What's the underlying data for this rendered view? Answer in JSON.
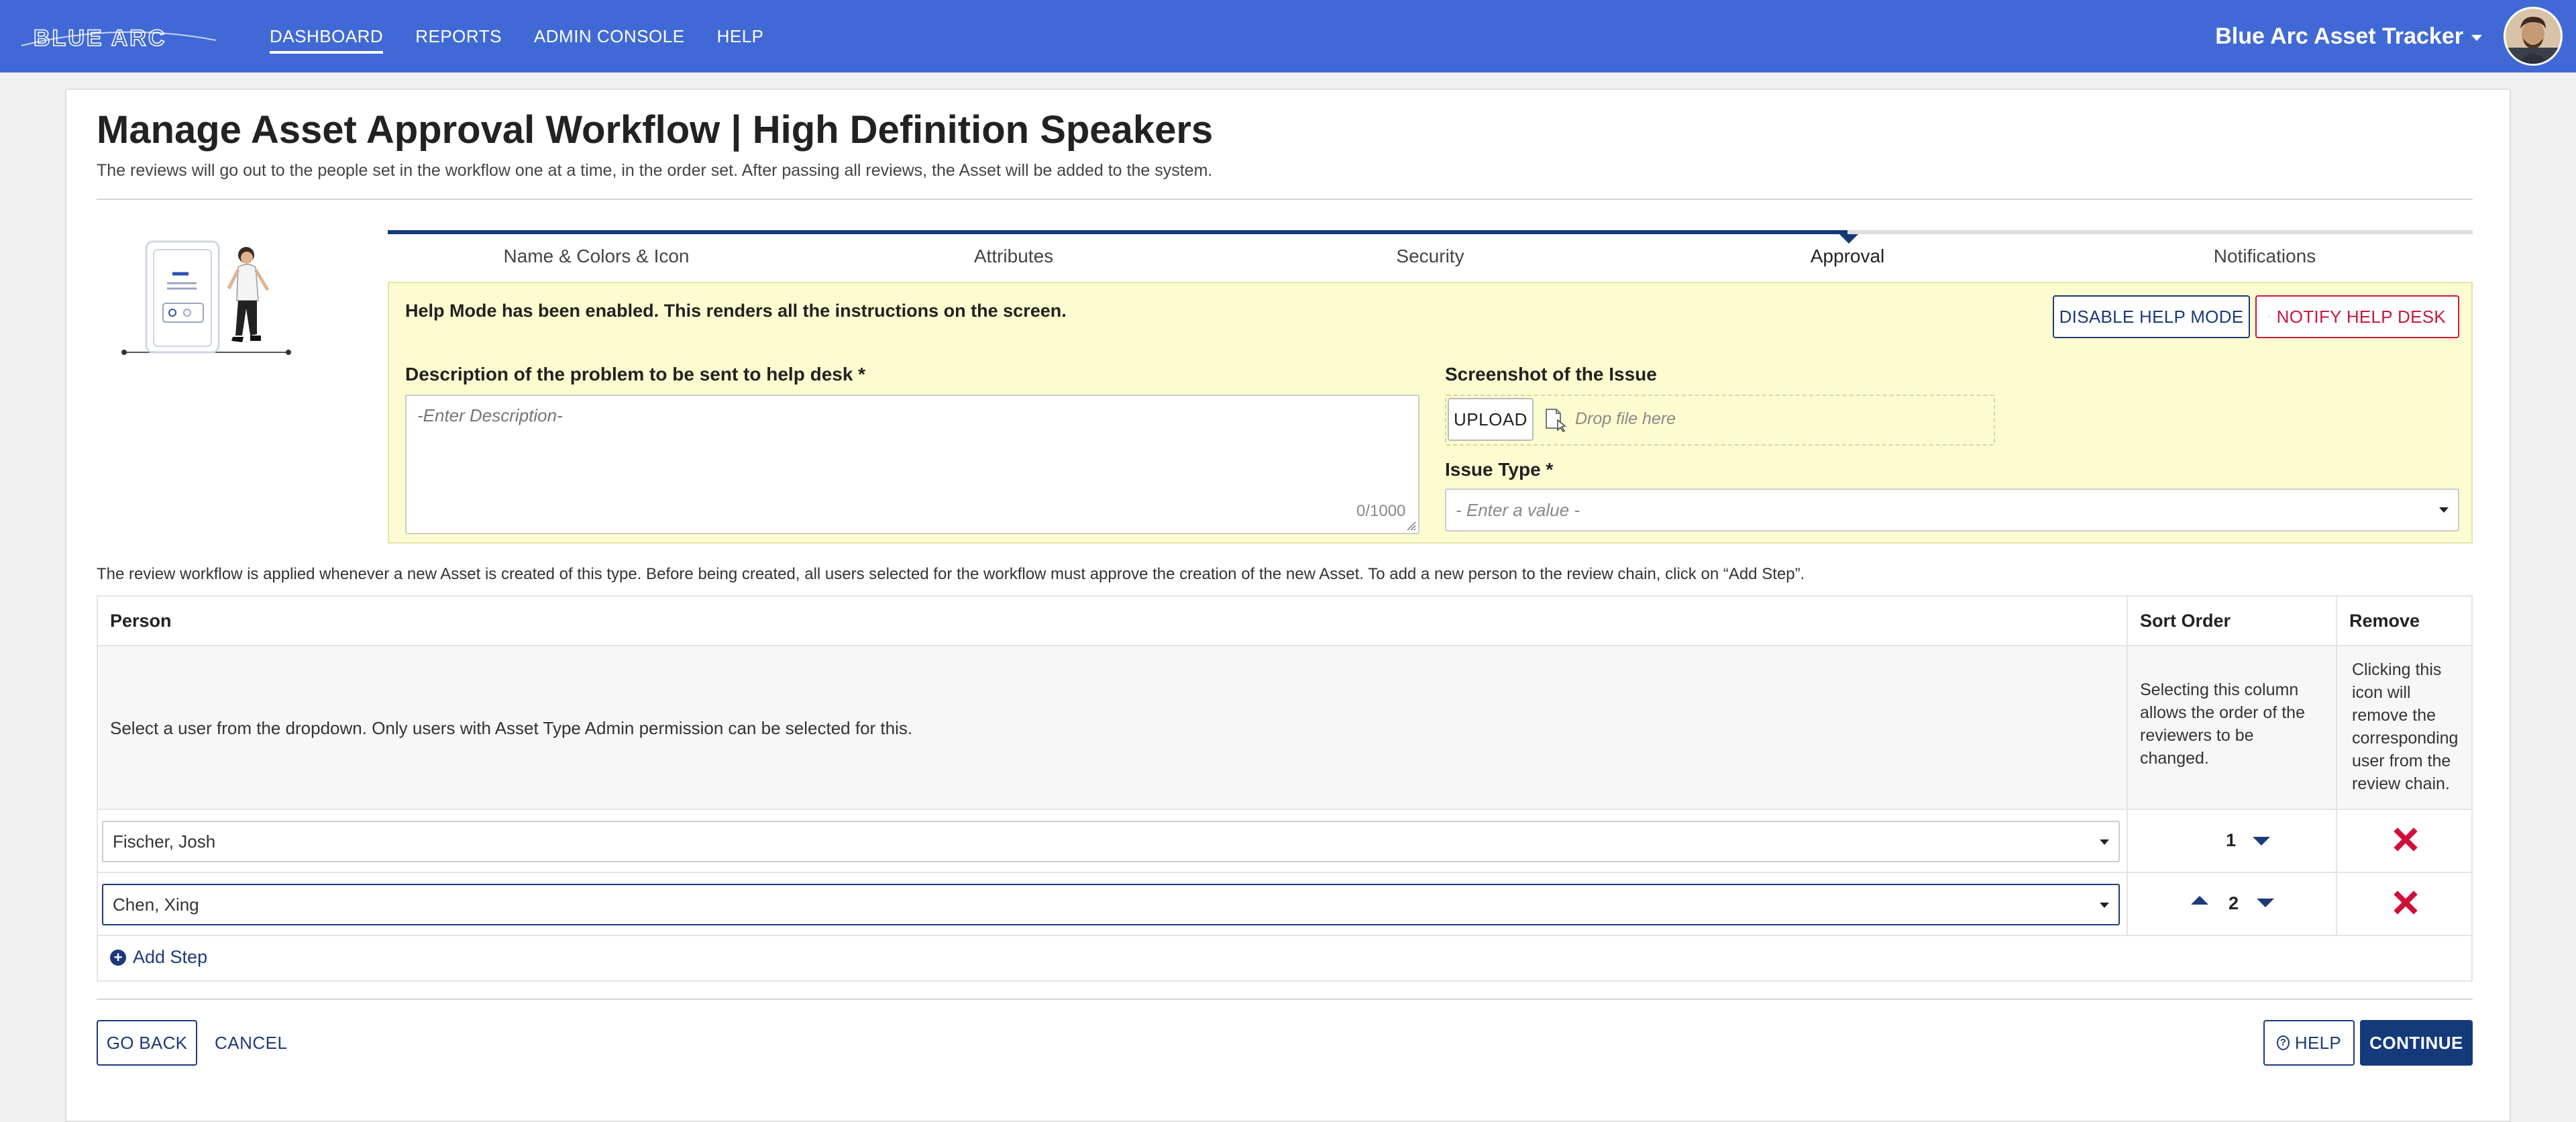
{
  "nav": {
    "logo_text": "BLUE ARC",
    "links": [
      {
        "label": "DASHBOARD",
        "active": true
      },
      {
        "label": "REPORTS",
        "active": false
      },
      {
        "label": "ADMIN CONSOLE",
        "active": false
      },
      {
        "label": "HELP",
        "active": false
      }
    ],
    "app_name": "Blue Arc Asset Tracker",
    "brand_color": "#4169d6"
  },
  "page": {
    "title": "Manage Asset Approval Workflow | High Definition Speakers",
    "subtitle": "The reviews will go out to the people set in the workflow one at a time, in the order set. After passing all reviews, the Asset will be added to the system."
  },
  "steps": {
    "items": [
      "Name & Colors & Icon",
      "Attributes",
      "Security",
      "Approval",
      "Notifications"
    ],
    "active_index": 3
  },
  "help_panel": {
    "notice": "Help Mode has been enabled. This renders all the instructions on the screen.",
    "disable_label": "DISABLE HELP MODE",
    "notify_label": "NOTIFY HELP DESK",
    "description_label": "Description of the problem to be sent to help desk *",
    "description_placeholder": "-Enter Description-",
    "char_count": "0/1000",
    "screenshot_label": "Screenshot of the Issue",
    "upload_label": "UPLOAD",
    "drop_text": "Drop file here",
    "issue_type_label": "Issue Type *",
    "issue_type_placeholder": "- Enter a value -",
    "background_color": "#fdfcd0"
  },
  "workflow": {
    "note": "The review workflow is applied whenever a new Asset is created of this type. Before being created, all users selected for the workflow must approve the creation of the new Asset. To add a new person to the review chain, click on “Add Step”.",
    "headers": {
      "person": "Person",
      "sort": "Sort Order",
      "remove": "Remove"
    },
    "help": {
      "person": "Select a user from the dropdown. Only users with Asset Type Admin permission can be selected for this.",
      "sort": "Selecting this column allows the order of the reviewers to be changed.",
      "remove": "Clicking this icon will remove the corresponding user from the review chain."
    },
    "rows": [
      {
        "person": "Fischer, Josh",
        "order": "1"
      },
      {
        "person": "Chen, Xing",
        "order": "2"
      }
    ],
    "add_step_label": "Add Step",
    "remove_color": "#d0103a"
  },
  "footer": {
    "go_back_label": "GO BACK",
    "cancel_label": "CANCEL",
    "help_label": "HELP",
    "continue_label": "CONTINUE",
    "primary_color": "#143a7a"
  }
}
